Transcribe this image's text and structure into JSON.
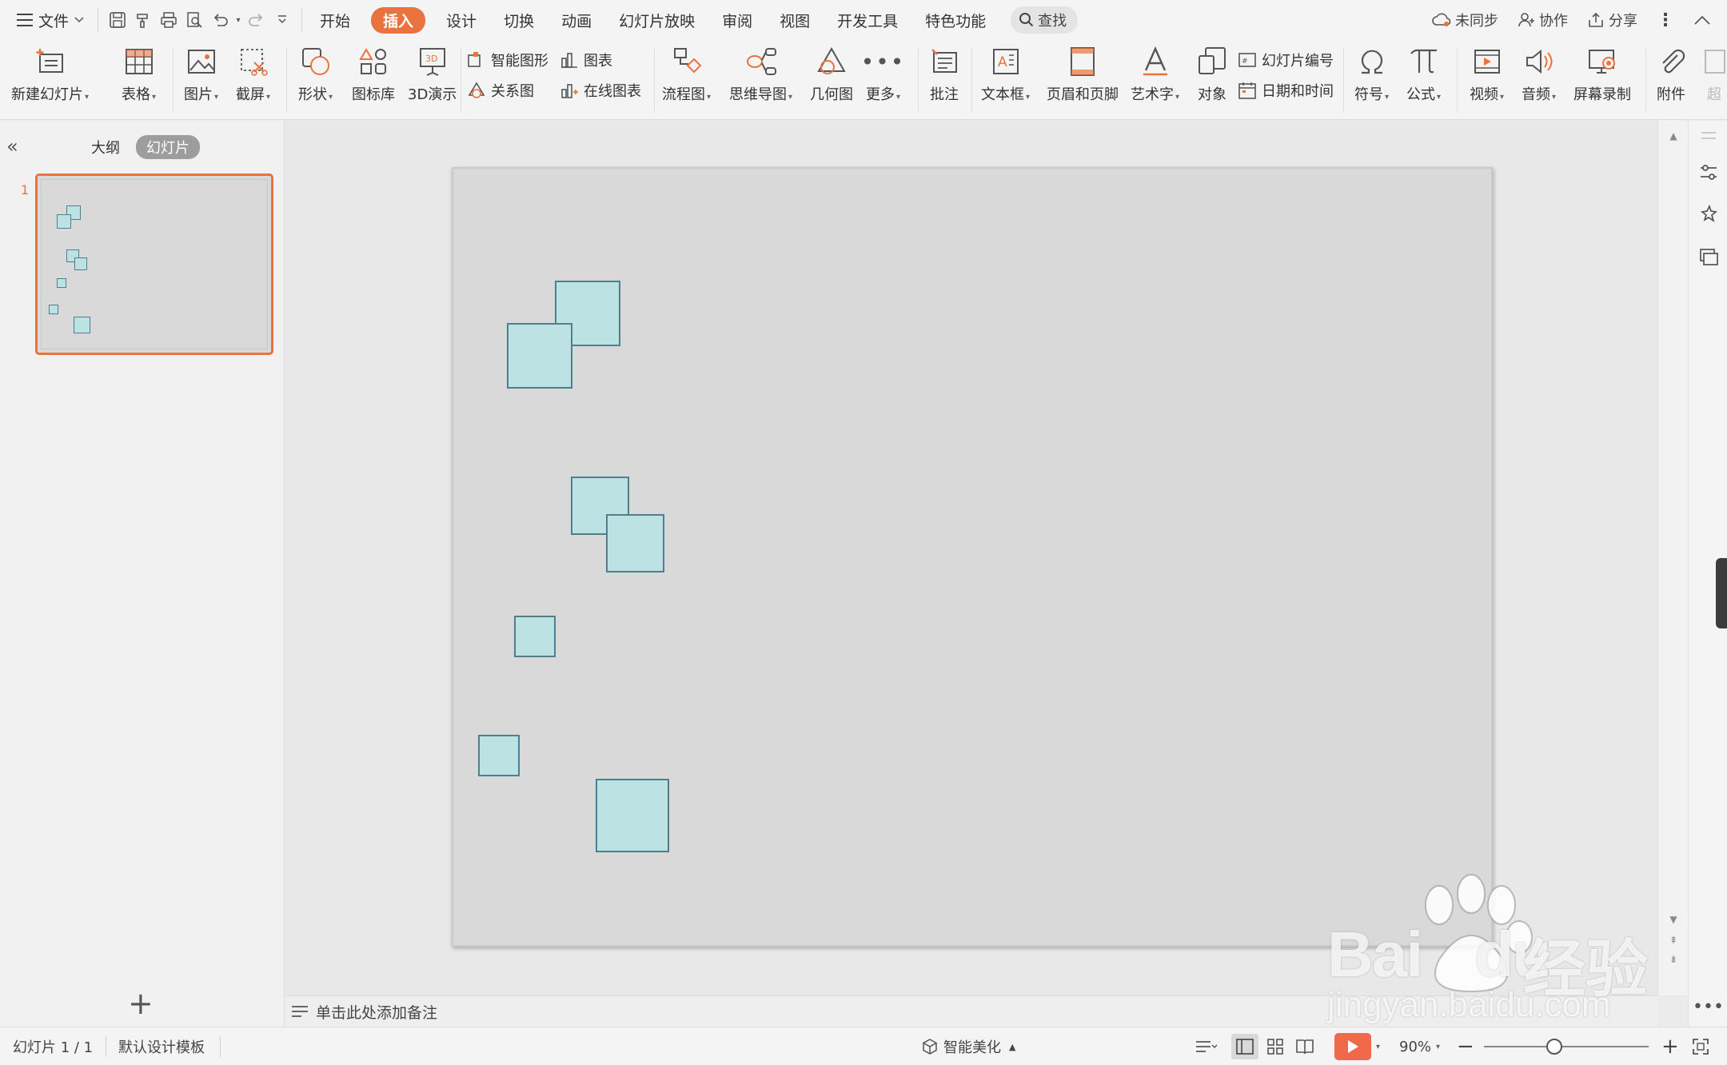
{
  "menubar": {
    "file_label": "文件",
    "tabs": [
      "开始",
      "插入",
      "设计",
      "切换",
      "动画",
      "幻灯片放映",
      "审阅",
      "视图",
      "开发工具",
      "特色功能"
    ],
    "active_tab": "插入",
    "search_label": "查找",
    "right": {
      "sync": "未同步",
      "collab": "协作",
      "share": "分享"
    }
  },
  "ribbon": {
    "new_slide": "新建幻灯片",
    "table": "表格",
    "picture": "图片",
    "screenshot": "截屏",
    "shape": "形状",
    "icon_lib": "图标库",
    "demo_3d": "3D演示",
    "smart_shape": "智能图形",
    "chart": "图表",
    "relation": "关系图",
    "online_chart": "在线图表",
    "flowchart": "流程图",
    "mindmap": "思维导图",
    "geometry": "几何图",
    "more": "更多",
    "comment": "批注",
    "textbox": "文本框",
    "header_footer": "页眉和页脚",
    "wordart": "艺术字",
    "object": "对象",
    "slide_number": "幻灯片编号",
    "date_time": "日期和时间",
    "symbol": "符号",
    "formula": "公式",
    "video": "视频",
    "audio": "音频",
    "screen_record": "屏幕录制",
    "attachment": "附件",
    "overflow": "超"
  },
  "left_panel": {
    "outline_tab": "大纲",
    "slides_tab": "幻灯片",
    "slide_number": "1"
  },
  "notes": {
    "placeholder": "单击此处添加备注"
  },
  "statusbar": {
    "slide_info": "幻灯片 1 / 1",
    "template": "默认设计模板",
    "smart_beautify": "智能美化",
    "zoom": "90%"
  },
  "watermark": {
    "brand": "Bai",
    "brand_suffix": "du",
    "cn": "经验",
    "url": "jingyan.baidu.com"
  },
  "colors": {
    "accent": "#e9733f",
    "shape_fill": "#bde2e4",
    "shape_border": "#4f7e8c",
    "slide_bg": "#d9d9d9",
    "play_button": "#f06a4a"
  }
}
